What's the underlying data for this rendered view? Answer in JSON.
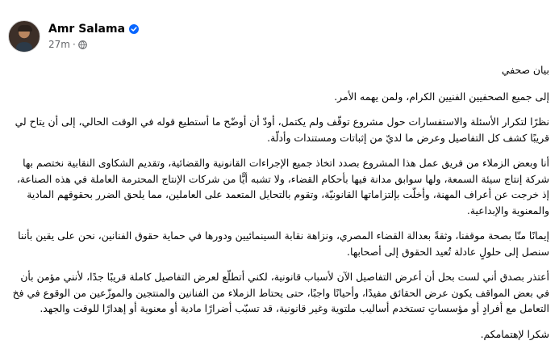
{
  "post": {
    "author": "Amr Salama",
    "time": "27m",
    "separator": "·",
    "paragraphs": [
      "بيان صحفي",
      "إلى جميع الصحفيين الفنيين الكرام، ولمن يهمه الأمر.",
      "نظرًا لتكرار الأسئلة والاستفسارات حول مشروع توقّف ولم يكتمل، أودّ أن أوضّح ما أستطيع قوله في الوقت الحالي، إلى أن يتاح لي قريبًا كشف كل التفاصيل وعرض ما لديّ من إثباتات ومستندات وأدلّة.",
      "أنا وبعض الزملاء من فريق عمل هذا المشروع بصدد اتخاذ جميع الإجراءات القانونية والقضائية، وتقديم الشكاوى النقابية نختصم بها شركة إنتاج سيئة السمعة، ولها سوابق مدانة فيها بأحكام القضاء، ولا تشبه أيًّا من شركات الإنتاج المحترمة العاملة في هذه الصناعة، إذ خرجت عن أعراف المهنة، وأخلّت بإلتزاماتها القانونيّة، وتقوم بالتحايل المتعمد على العاملين، مما يلحق الضرر بحقوقهم المادية والمعنوية والإبداعية.",
      "إيمانًا منّا بصحة موقفنا، وثقةً بعدالة القضاء المصري، ونزاهة نقابة السينمائيين ودورها في حماية حقوق الفنانين، نحن على يقين بأننا سنصل إلى حلولٍ عادلة تُعيد الحقوق إلى أصحابها.",
      "أعتذر بصدق أني لست بحل أن أعرض التفاصيل الآن لأسباب قانونية، لكني أتطلّع لعرض التفاصيل كاملة قريبًا جدًا، لأنني مؤمن بأن في بعض المواقف يكون عرض الحقائق مفيدًا، وأحيانًا واجبًا، حتى يحتاط الزملاء من الفنانين والمنتجين والموزّعين من الوقوع في فخ التعامل مع أفرادٍ أو مؤسساتٍ تستخدم أساليب ملتوية وغير قانونية، قد تسبّب أضرارًا مادية أو معنوية أو إهدارًا للوقت والجهد.",
      "شكرا لإهتمامكم."
    ]
  }
}
